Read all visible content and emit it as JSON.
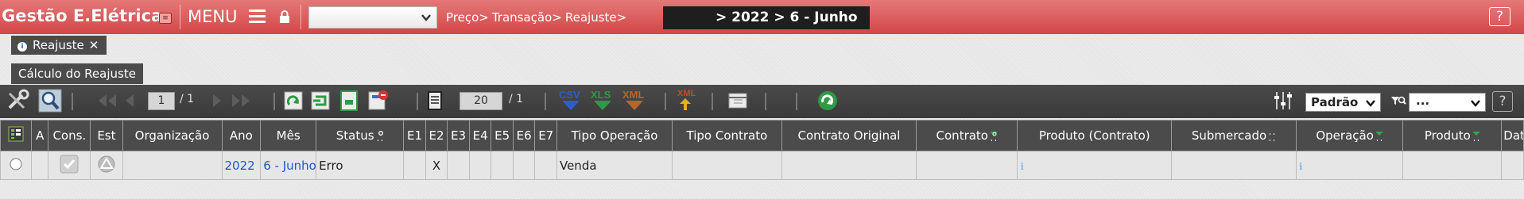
{
  "header": {
    "app_title": "Gestão E.Elétrica",
    "menu_label": "MENU",
    "breadcrumb": [
      "Preço>",
      "Transação>",
      "Reajuste>"
    ],
    "period": "> 2022 > 6 - Junho",
    "help": "?"
  },
  "tabs": [
    {
      "label": "Reajuste",
      "close": "✕"
    }
  ],
  "section": {
    "title": "Cálculo do Reajuste"
  },
  "toolbar": {
    "page_current": "1",
    "page_total": "/ 1",
    "page_size": "20",
    "page_size_total": "/ 1",
    "export_csv": "CSV",
    "export_xls": "XLS",
    "export_xml": "XML",
    "export_xml2": "XML",
    "preset": "Padrão",
    "filter": "...",
    "help": "?"
  },
  "table": {
    "columns": [
      "A",
      "Cons.",
      "Est",
      "Organização",
      "Ano",
      "Mês",
      "Status",
      "E1",
      "E2",
      "E3",
      "E4",
      "E5",
      "E6",
      "E7",
      "Tipo Operação",
      "Tipo Contrato",
      "Contrato Original",
      "Contrato",
      "Produto (Contrato)",
      "Submercado",
      "Operação",
      "Produto",
      "Data"
    ],
    "rows": [
      {
        "organizacao": "",
        "ano": "2022",
        "mes": "6 - Junho",
        "status": "Erro",
        "e1": "",
        "e2": "X",
        "e3": "",
        "e4": "",
        "e5": "",
        "e6": "",
        "e7": "",
        "tipo_operacao": "Venda",
        "tipo_contrato": "",
        "contrato_original": "",
        "contrato": "",
        "produto_contrato": "ℹ",
        "submercado": "",
        "operacao": "ℹ",
        "produto": "",
        "data": ""
      }
    ]
  },
  "colors": {
    "topbar": "#d34646",
    "dark": "#4b4b4b",
    "link": "#1f55c8",
    "sort_green": "#2aa84a"
  }
}
